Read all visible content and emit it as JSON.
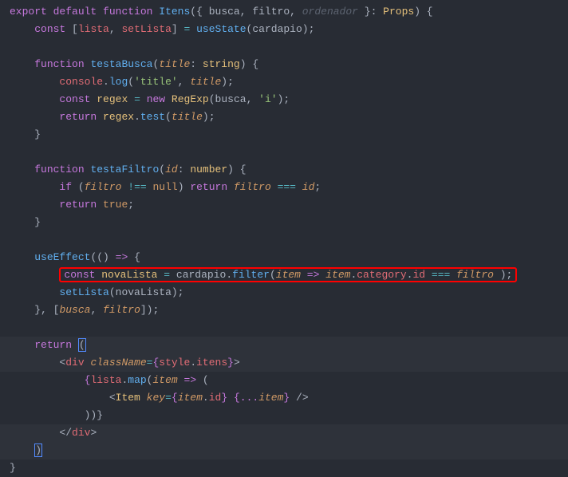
{
  "code": {
    "l1": {
      "export": "export",
      "default": "default",
      "function": "function",
      "fn": "Itens",
      "params": "{ busca, filtro, ",
      "unused": "ordenador",
      "params2": " }",
      "colon": ": ",
      "type": "Props",
      "end": ") {"
    },
    "l2": {
      "indent": "    ",
      "const": "const",
      "arr": " [",
      "v1": "lista",
      "c": ", ",
      "v2": "setLista",
      "arr2": "] ",
      "eq": "=",
      "sp": " ",
      "fn": "useState",
      "p": "(",
      "arg": "cardapio",
      "end": ");"
    },
    "l3": "",
    "l4": {
      "indent": "    ",
      "function": "function",
      "sp": " ",
      "fn": "testaBusca",
      "p": "(",
      "param": "title",
      "colon": ": ",
      "type": "string",
      "end": ") {"
    },
    "l5": {
      "indent": "        ",
      "obj": "console",
      "dot": ".",
      "fn": "log",
      "p": "(",
      "s1": "'title'",
      "c": ", ",
      "arg": "title",
      "end": ");"
    },
    "l6": {
      "indent": "        ",
      "const": "const",
      "sp": " ",
      "v": "regex",
      "sp2": " ",
      "eq": "=",
      "sp3": " ",
      "new": "new",
      "sp4": " ",
      "cls": "RegExp",
      "p": "(",
      "arg": "busca",
      "c": ", ",
      "s": "'i'",
      "end": ");"
    },
    "l7": {
      "indent": "        ",
      "return": "return",
      "sp": " ",
      "v": "regex",
      "dot": ".",
      "fn": "test",
      "p": "(",
      "arg": "title",
      "end": ");"
    },
    "l8": {
      "indent": "    ",
      "brace": "}"
    },
    "l9": "",
    "l10": {
      "indent": "    ",
      "function": "function",
      "sp": " ",
      "fn": "testaFiltro",
      "p": "(",
      "param": "id",
      "colon": ": ",
      "type": "number",
      "end": ") {"
    },
    "l11": {
      "indent": "        ",
      "if": "if",
      "sp": " (",
      "arg": "filtro",
      "sp2": " ",
      "op": "!==",
      "sp3": " ",
      "null": "null",
      "end": ") ",
      "return": "return",
      "sp4": " ",
      "arg2": "filtro",
      "sp5": " ",
      "op2": "===",
      "sp6": " ",
      "arg3": "id",
      "semi": ";"
    },
    "l12": {
      "indent": "        ",
      "return": "return",
      "sp": " ",
      "true": "true",
      "semi": ";"
    },
    "l13": {
      "indent": "    ",
      "brace": "}"
    },
    "l14": "",
    "l15": {
      "indent": "    ",
      "fn": "useEffect",
      "p": "(() ",
      "arrow": "=>",
      "end": " {"
    },
    "l16": {
      "indent": "        ",
      "const": "const",
      "sp": " ",
      "v": "novaLista",
      "sp2": " ",
      "eq": "=",
      "sp3": " ",
      "obj": "cardapio",
      "dot": ".",
      "fn": "filter",
      "p": "(",
      "param": "item",
      "sp4": " ",
      "arrow": "=>",
      "sp5": " ",
      "param2": "item",
      "dot2": ".",
      "prop": "category",
      "dot3": ".",
      "prop2": "id",
      "sp6": " ",
      "op": "===",
      "sp7": " ",
      "arg": "filtro",
      "sp8": " ",
      "end": ");"
    },
    "l17": {
      "indent": "        ",
      "fn": "setLista",
      "p": "(",
      "arg": "novaLista",
      "end": ");"
    },
    "l18": {
      "indent": "    ",
      "brace": "}, [",
      "v1": "busca",
      "c": ", ",
      "v2": "filtro",
      "end": "]);"
    },
    "l19": "",
    "l20": {
      "indent": "    ",
      "return": "return",
      "sp": " ",
      "paren": "("
    },
    "l21": {
      "indent": "        ",
      "lt": "<",
      "tag": "div",
      "sp": " ",
      "attr": "className",
      "eq": "=",
      "b1": "{",
      "obj": "style",
      "dot": ".",
      "prop": "itens",
      "b2": "}",
      "gt": ">"
    },
    "l22": {
      "indent": "            ",
      "b1": "{",
      "obj": "lista",
      "dot": ".",
      "fn": "map",
      "p": "(",
      "param": "item",
      "sp": " ",
      "arrow": "=>",
      "end": " ("
    },
    "l23": {
      "indent": "                ",
      "lt": "<",
      "tag": "Item",
      "sp": " ",
      "attr": "key",
      "eq": "=",
      "b1": "{",
      "obj": "item",
      "dot": ".",
      "prop": "id",
      "b2": "}",
      "sp2": " ",
      "spread": "{...",
      "obj2": "item",
      "b3": "}",
      "sp3": " ",
      "end": "/>"
    },
    "l24": {
      "indent": "            ",
      "end": "))}"
    },
    "l25": {
      "indent": "        ",
      "lt": "</",
      "tag": "div",
      "gt": ">"
    },
    "l26": {
      "indent": "    ",
      "paren": ")"
    },
    "l27": {
      "brace": "}"
    }
  }
}
